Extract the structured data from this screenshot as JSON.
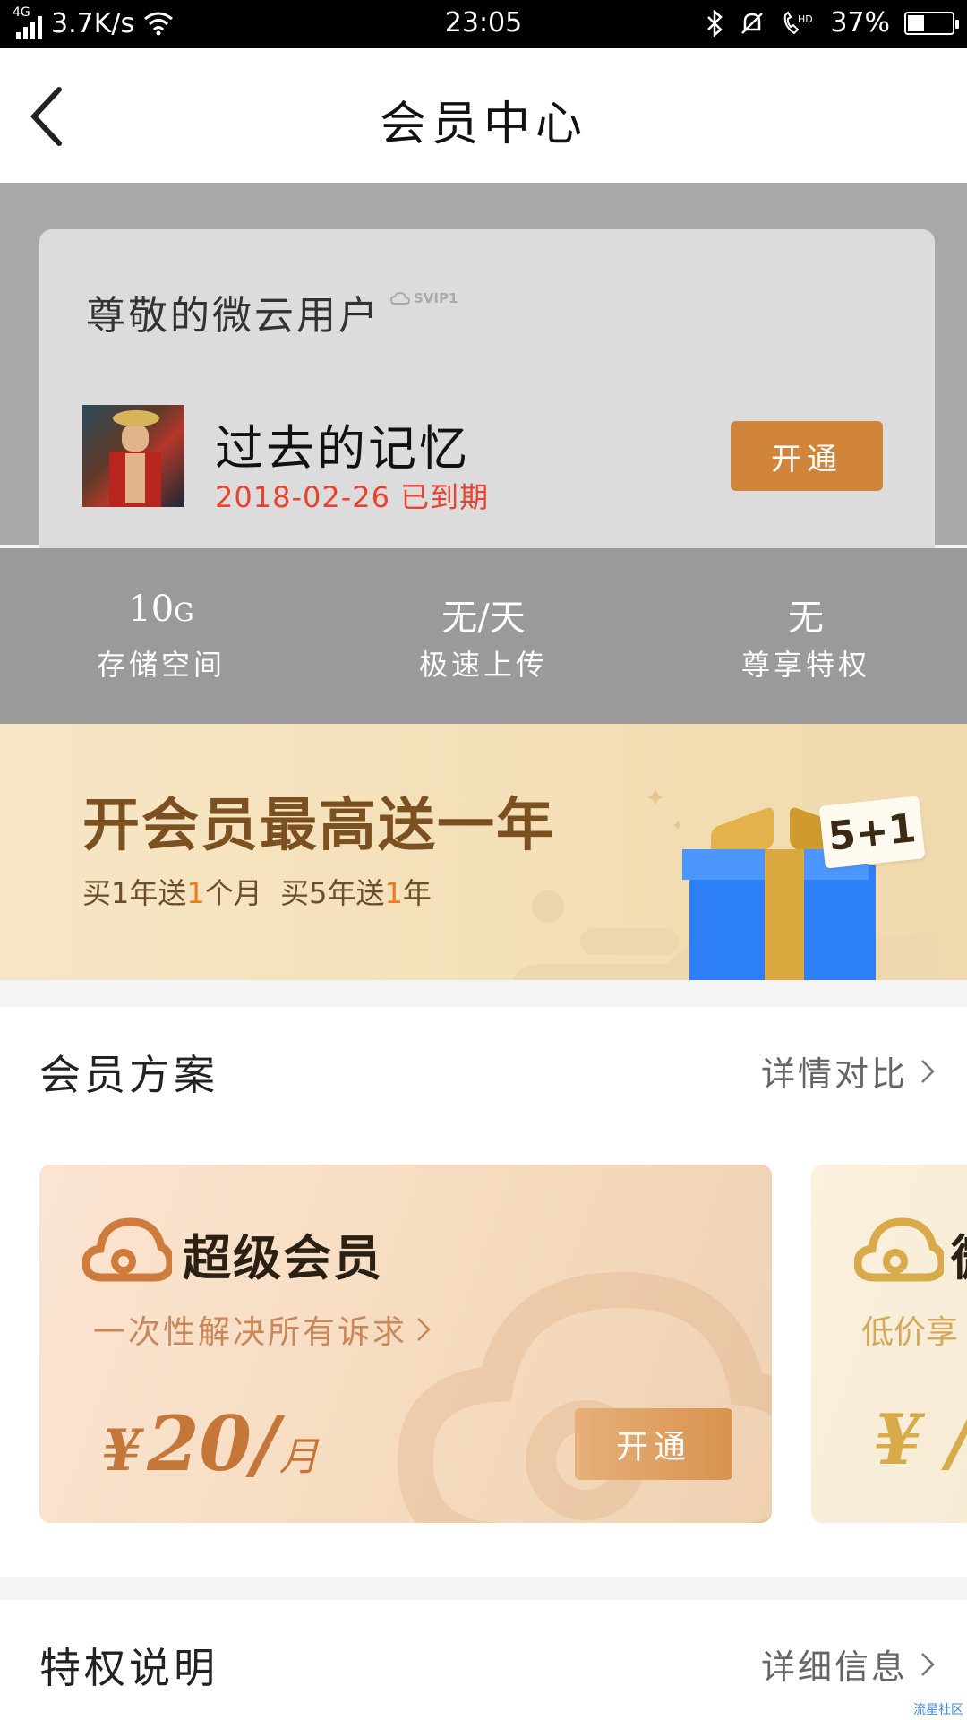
{
  "status_bar": {
    "network": "4G",
    "speed": "3.7K/s",
    "time": "23:05",
    "battery": "37%",
    "battery_level": 0.37,
    "icons": [
      "signal-icon",
      "wifi-icon",
      "bluetooth-icon",
      "mute-icon",
      "hd-call-icon",
      "battery-icon"
    ]
  },
  "header": {
    "title": "会员中心",
    "back_icon": "back-arrow-icon"
  },
  "profile": {
    "greeting": "尊敬的微云用户",
    "badge": "SVIP1",
    "username": "过去的记忆",
    "expiry": "2018-02-26 已到期",
    "open_label": "开通"
  },
  "stats": [
    {
      "value": "10",
      "unit": "G",
      "label": "存储空间"
    },
    {
      "value": "无/天",
      "unit": "",
      "label": "极速上传"
    },
    {
      "value": "无",
      "unit": "",
      "label": "尊享特权"
    }
  ],
  "banner": {
    "title": "开会员最高送一年",
    "sub_parts": [
      "买1年送",
      "1",
      "个月  买5年送",
      "1",
      "年"
    ],
    "tag": "5+1"
  },
  "plans_section": {
    "title": "会员方案",
    "link": "详情对比"
  },
  "plans": [
    {
      "name": "超级会员",
      "desc": "一次性解决所有诉求",
      "currency": "¥",
      "price": "20/",
      "unit": "月",
      "button": "开通"
    },
    {
      "name": "微",
      "desc": "低价享",
      "price": "¥ /"
    }
  ],
  "privilege_section": {
    "title": "特权说明",
    "link": "详细信息"
  },
  "watermark": "流星社区",
  "colors": {
    "accent_orange": "#d0853b",
    "expired_red": "#e8432e",
    "banner_brown": "#7b5122",
    "gift_blue": "#2d7ff5"
  }
}
